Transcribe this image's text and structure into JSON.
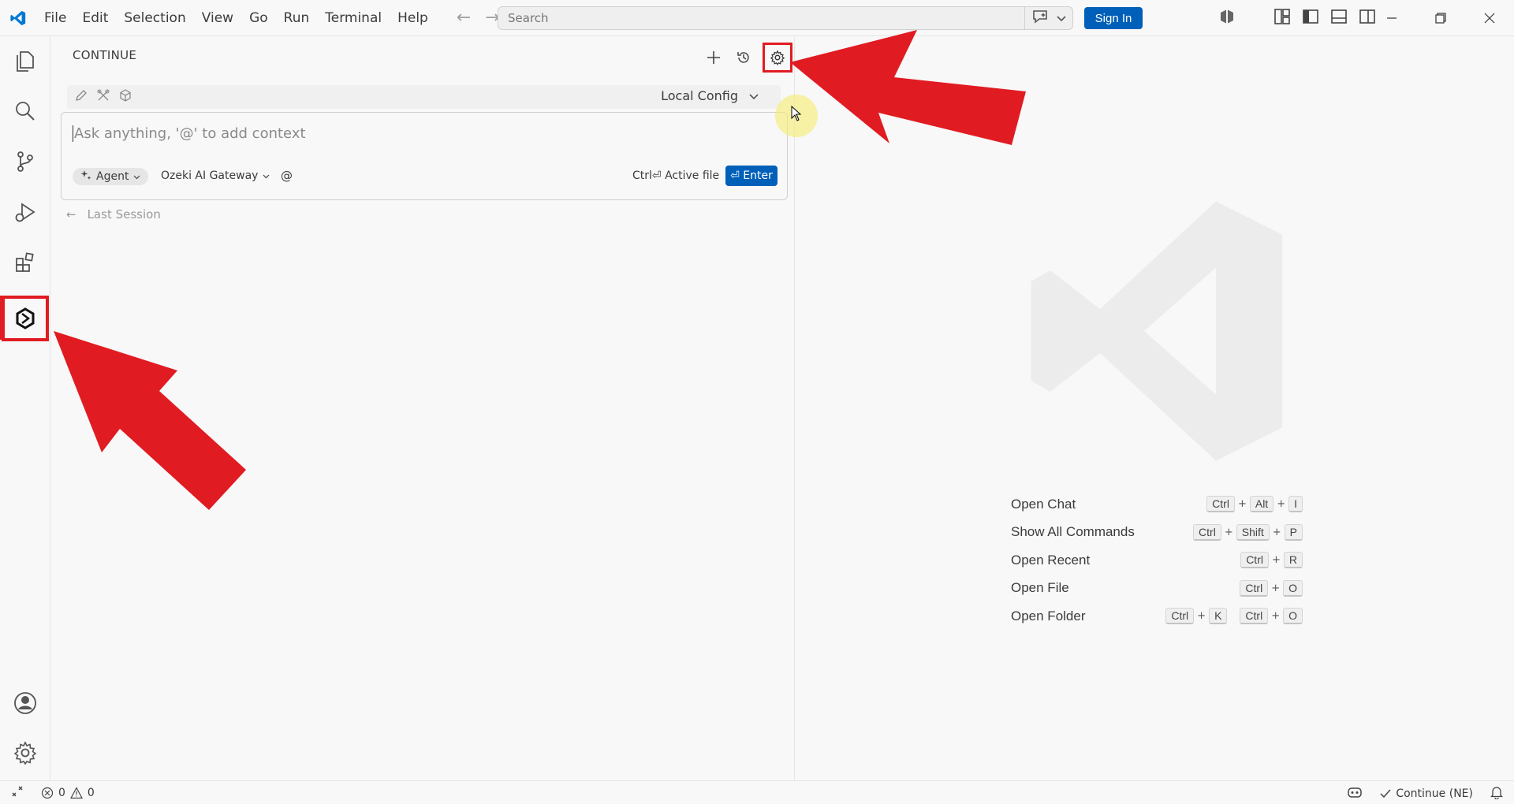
{
  "menu": [
    "File",
    "Edit",
    "Selection",
    "View",
    "Go",
    "Run",
    "Terminal",
    "Help"
  ],
  "search": {
    "placeholder": "Search"
  },
  "signin_label": "Sign In",
  "panel": {
    "title": "CONTINUE",
    "config_label": "Local Config",
    "input_placeholder": "Ask anything, '@' to add context",
    "agent_label": "Agent",
    "model_label": "Ozeki AI Gateway",
    "at_label": "@",
    "active_file_label": "Ctrl⏎ Active file",
    "enter_label": "⏎ Enter",
    "last_session_label": "Last Session"
  },
  "shortcuts": [
    {
      "label": "Open Chat",
      "keys": [
        [
          "Ctrl",
          "Alt",
          "I"
        ]
      ]
    },
    {
      "label": "Show All Commands",
      "keys": [
        [
          "Ctrl",
          "Shift",
          "P"
        ]
      ]
    },
    {
      "label": "Open Recent",
      "keys": [
        [
          "Ctrl",
          "R"
        ]
      ]
    },
    {
      "label": "Open File",
      "keys": [
        [
          "Ctrl",
          "O"
        ]
      ]
    },
    {
      "label": "Open Folder",
      "keys": [
        [
          "Ctrl",
          "K"
        ],
        [
          "Ctrl",
          "O"
        ]
      ]
    }
  ],
  "status": {
    "errors": "0",
    "warnings": "0",
    "continue_label": "Continue (NE)"
  },
  "colors": {
    "accent": "#005fb8",
    "highlight": "#e11b22"
  },
  "icons": {
    "activity": [
      "explorer-icon",
      "search-icon",
      "source-control-icon",
      "run-debug-icon",
      "extensions-icon",
      "continue-icon",
      "account-icon",
      "settings-icon"
    ]
  }
}
